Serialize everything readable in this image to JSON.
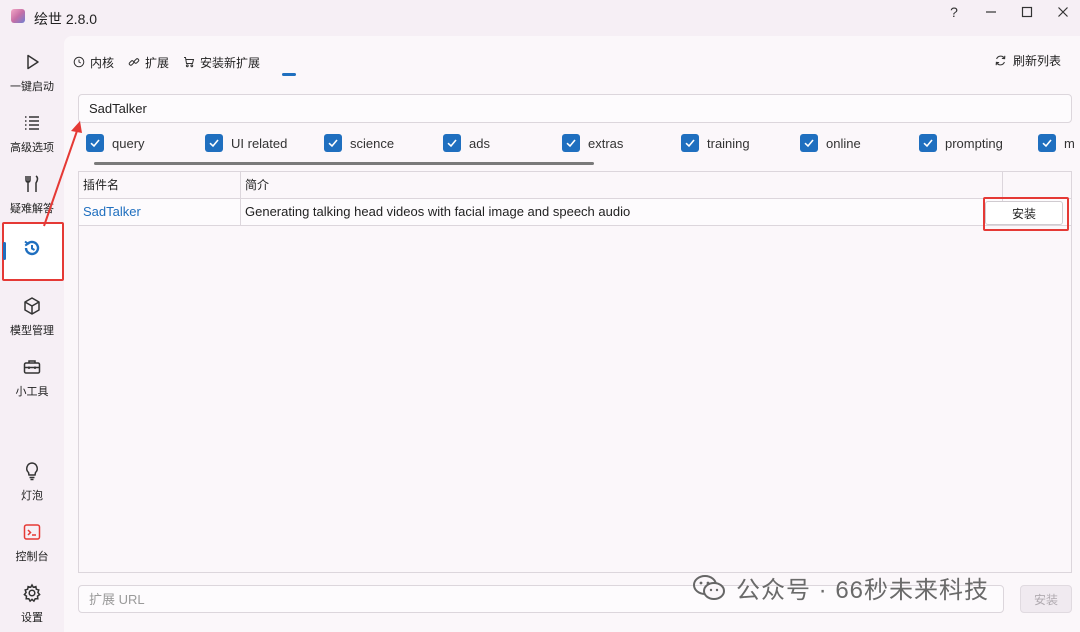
{
  "window": {
    "title": "绘世 2.8.0",
    "help_label": "?"
  },
  "sidebar": {
    "items": [
      {
        "label": "一键启动",
        "icon": "play-icon"
      },
      {
        "label": "高级选项",
        "icon": "list-icon"
      },
      {
        "label": "疑难解答",
        "icon": "tools-icon"
      },
      {
        "label": "",
        "icon": "history-icon",
        "active": true
      },
      {
        "label": "模型管理",
        "icon": "cube-icon"
      },
      {
        "label": "小工具",
        "icon": "toolbox-icon"
      },
      {
        "label": "灯泡",
        "icon": "lightbulb-icon"
      },
      {
        "label": "控制台",
        "icon": "console-icon"
      },
      {
        "label": "设置",
        "icon": "gear-icon"
      }
    ]
  },
  "tabs": [
    {
      "label": "内核",
      "icon": "clock-icon"
    },
    {
      "label": "扩展",
      "icon": "link-icon"
    },
    {
      "label": "安装新扩展",
      "icon": "cart-icon",
      "active": true
    }
  ],
  "refresh_label": "刷新列表",
  "search": {
    "value": "SadTalker"
  },
  "filters": [
    "query",
    "UI related",
    "science",
    "ads",
    "extras",
    "training",
    "online",
    "prompting",
    "m"
  ],
  "table": {
    "columns": [
      "插件名",
      "简介",
      ""
    ],
    "rows": [
      {
        "name": "SadTalker",
        "description": "Generating talking head videos with facial image and speech audio",
        "action": "安装"
      }
    ]
  },
  "url_input": {
    "placeholder": "扩展 URL"
  },
  "url_install_label": "安装",
  "watermark": "公众号 · 66秒未来科技",
  "colors": {
    "accent": "#1f6fbf",
    "highlight": "#e53935",
    "background": "#f6eff5"
  }
}
